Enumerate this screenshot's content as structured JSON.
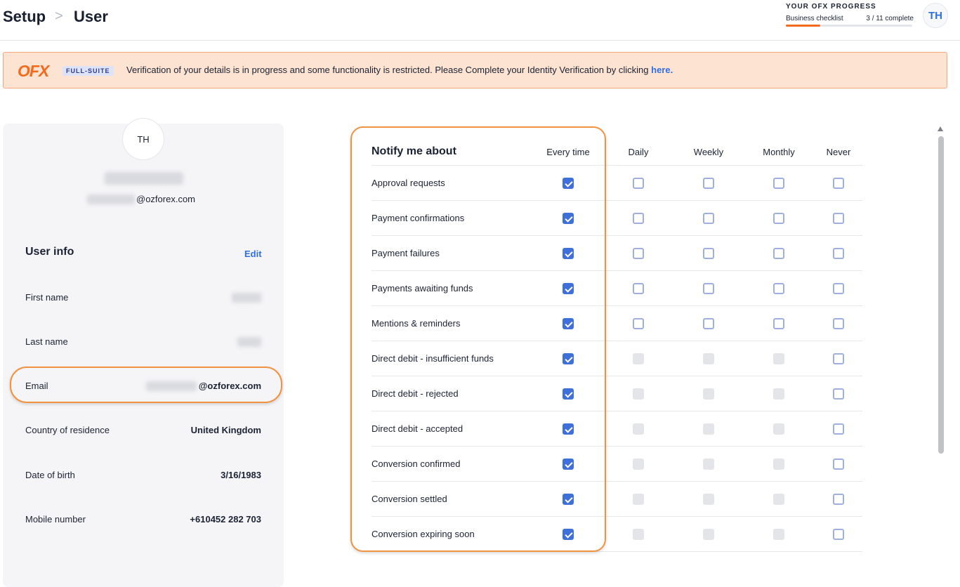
{
  "breadcrumb": {
    "root": "Setup",
    "separator": ">",
    "current": "User"
  },
  "progress": {
    "title": "YOUR OFX PROGRESS",
    "label": "Business checklist",
    "count": "3 / 11 complete",
    "fraction": 0.27
  },
  "user_avatar_initials": "TH",
  "banner": {
    "logo": "OFX",
    "badge": "FULL-SUITE",
    "message": "Verification of your details is in progress and some functionality is restricted. Please Complete your Identity Verification by clicking ",
    "link": "here."
  },
  "profile": {
    "initials": "TH",
    "email_domain": "@ozforex.com"
  },
  "user_info": {
    "title": "User info",
    "edit_label": "Edit",
    "fields": [
      {
        "label": "First name",
        "value": ""
      },
      {
        "label": "Last name",
        "value": ""
      },
      {
        "label": "Email",
        "value": "@ozforex.com"
      },
      {
        "label": "Country of residence",
        "value": "United Kingdom"
      },
      {
        "label": "Date of birth",
        "value": "3/16/1983"
      },
      {
        "label": "Mobile number",
        "value": "+610452 282 703"
      }
    ]
  },
  "notifications": {
    "title": "Notify me about",
    "columns": [
      "Every time",
      "Daily",
      "Weekly",
      "Monthly",
      "Never"
    ],
    "rows": [
      {
        "label": "Approval requests",
        "states": [
          "checked",
          "empty",
          "empty",
          "empty",
          "empty"
        ]
      },
      {
        "label": "Payment confirmations",
        "states": [
          "checked",
          "empty",
          "empty",
          "empty",
          "empty"
        ]
      },
      {
        "label": "Payment failures",
        "states": [
          "checked",
          "empty",
          "empty",
          "empty",
          "empty"
        ]
      },
      {
        "label": "Payments awaiting funds",
        "states": [
          "checked",
          "empty",
          "empty",
          "empty",
          "empty"
        ]
      },
      {
        "label": "Mentions & reminders",
        "states": [
          "checked",
          "empty",
          "empty",
          "empty",
          "empty"
        ]
      },
      {
        "label": "Direct debit - insufficient funds",
        "states": [
          "checked",
          "disabled",
          "disabled",
          "disabled",
          "empty"
        ]
      },
      {
        "label": "Direct debit - rejected",
        "states": [
          "checked",
          "disabled",
          "disabled",
          "disabled",
          "empty"
        ]
      },
      {
        "label": "Direct debit - accepted",
        "states": [
          "checked",
          "disabled",
          "disabled",
          "disabled",
          "empty"
        ]
      },
      {
        "label": "Conversion confirmed",
        "states": [
          "checked",
          "disabled",
          "disabled",
          "disabled",
          "empty"
        ]
      },
      {
        "label": "Conversion settled",
        "states": [
          "checked",
          "disabled",
          "disabled",
          "disabled",
          "empty"
        ]
      },
      {
        "label": "Conversion expiring soon",
        "states": [
          "checked",
          "disabled",
          "disabled",
          "disabled",
          "empty"
        ]
      }
    ]
  },
  "colors": {
    "accent_blue": "#3f6fd8",
    "brand_orange": "#f26b1d",
    "highlight_orange": "#f0923f",
    "banner_bg": "#fde3d2"
  }
}
